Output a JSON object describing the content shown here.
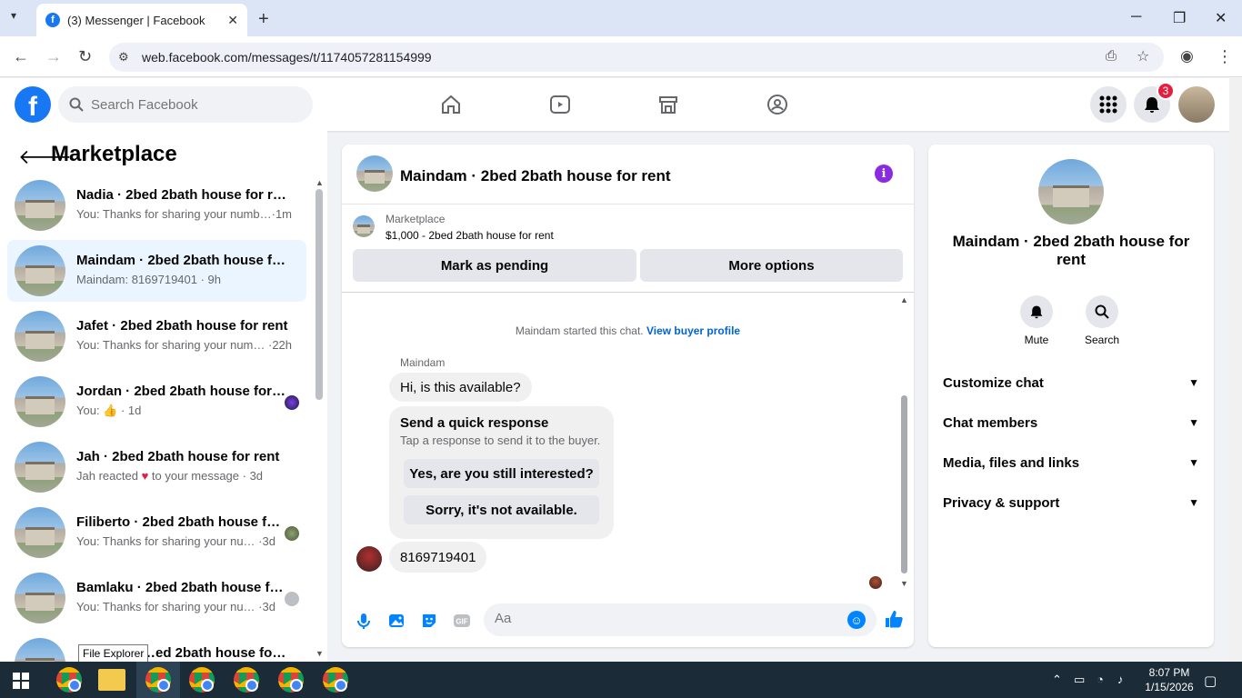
{
  "browser": {
    "tab_title": "(3) Messenger | Facebook",
    "url": "web.facebook.com/messages/t/1174057281154999"
  },
  "header": {
    "search_placeholder": "Search Facebook",
    "notification_count": "3"
  },
  "sidebar": {
    "title": "Marketplace",
    "conversations": [
      {
        "name": "Nadia · 2bed 2bath house for rent",
        "snippet": "You: Thanks for sharing your numb…·1m"
      },
      {
        "name": "Maindam · 2bed 2bath house fo…",
        "snippet": "Maindam: 8169719401 · 9h"
      },
      {
        "name": "Jafet · 2bed 2bath house for rent",
        "snippet": "You: Thanks for sharing your num… ·22h"
      },
      {
        "name": "Jordan · 2bed 2bath house for…",
        "snippet": "You: 👍 · 1d"
      },
      {
        "name": "Jah · 2bed 2bath house for rent",
        "snippet_a": "Jah reacted",
        "snippet_b": "to your message · 3d"
      },
      {
        "name": "Filiberto · 2bed 2bath house f…",
        "snippet": "You: Thanks for sharing your nu… ·3d"
      },
      {
        "name": "Bamlaku · 2bed 2bath house f…",
        "snippet": "You: Thanks for sharing your nu… ·3d"
      },
      {
        "name": "…ed 2bath house fo…"
      }
    ],
    "tooltip": "File Explorer"
  },
  "chat": {
    "title": "Maindam · 2bed 2bath house for rent",
    "listing_label": "Marketplace",
    "listing_price": "$1,000 - 2bed 2bath house for rent",
    "mark_pending": "Mark as pending",
    "more_options": "More options",
    "started_text": "Maindam started this chat.",
    "view_buyer": "View buyer profile",
    "sender_name": "Maindam",
    "message_1": "Hi, is this available?",
    "quick_title": "Send a quick response",
    "quick_sub": "Tap a response to send it to the buyer.",
    "quick_1": "Yes, are you still interested?",
    "quick_2": "Sorry, it's not available.",
    "message_2": "8169719401",
    "composer_placeholder": "Aa"
  },
  "info": {
    "title": "Maindam · 2bed 2bath house for rent",
    "mute": "Mute",
    "search": "Search",
    "rows": [
      "Customize chat",
      "Chat members",
      "Media, files and links",
      "Privacy & support"
    ]
  },
  "taskbar": {
    "time": "8:07 PM",
    "date": "1/15/2026"
  },
  "colors": {
    "brand": "#1877f2",
    "messenger": "#0084ff",
    "active_row": "#ebf5ff",
    "badge": "#e41e3f"
  }
}
